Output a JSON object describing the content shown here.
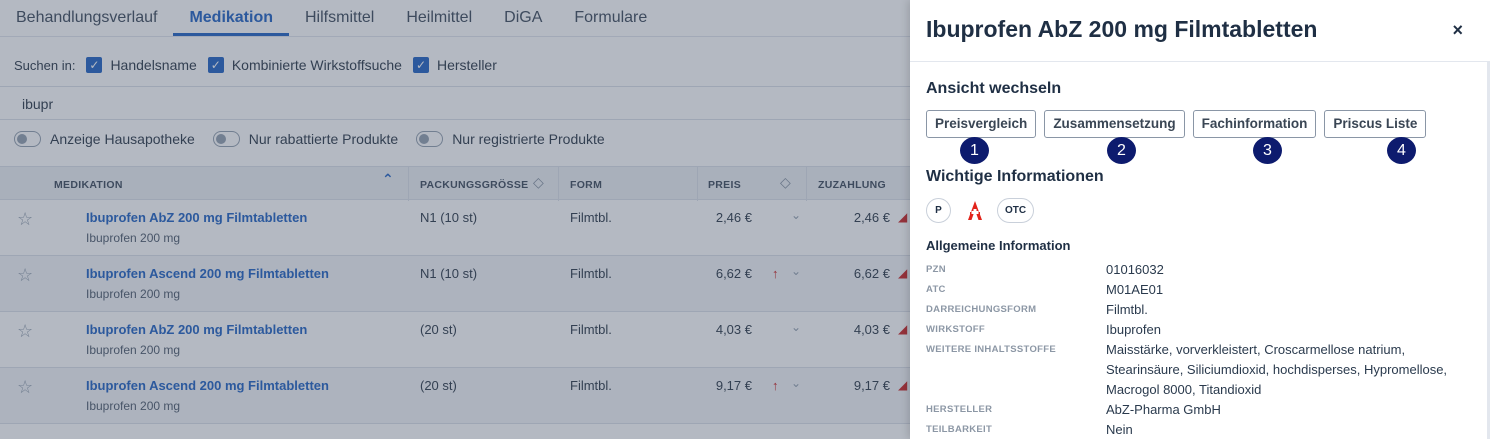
{
  "tabs": [
    "Behandlungsverlauf",
    "Medikation",
    "Hilfsmittel",
    "Heilmittel",
    "DiGA",
    "Formulare"
  ],
  "active_tab": "Medikation",
  "search": {
    "label": "Suchen in:",
    "options": [
      "Handelsname",
      "Kombinierte Wirkstoffsuche",
      "Hersteller"
    ],
    "value": "ibupr"
  },
  "toggles": [
    "Anzeige Hausapotheke",
    "Nur rabattierte Produkte",
    "Nur registrierte Produkte"
  ],
  "table": {
    "headers": [
      "MEDIKATION",
      "PACKUNGSGRÖSSE",
      "FORM",
      "PREIS",
      "ZUZAHLUNG"
    ],
    "rows": [
      {
        "name": "Ibuprofen AbZ 200 mg Filmtabletten",
        "sub": "Ibuprofen 200 mg",
        "size": "N1 (10 st)",
        "form": "Filmtbl.",
        "price": "2,46 €",
        "up": false,
        "copay": "2,46 €"
      },
      {
        "name": "Ibuprofen Ascend 200 mg Filmtabletten",
        "sub": "Ibuprofen 200 mg",
        "size": "N1 (10 st)",
        "form": "Filmtbl.",
        "price": "6,62 €",
        "up": true,
        "copay": "6,62 €"
      },
      {
        "name": "Ibuprofen AbZ 200 mg Filmtabletten",
        "sub": "Ibuprofen 200 mg",
        "size": "(20 st)",
        "form": "Filmtbl.",
        "price": "4,03 €",
        "up": false,
        "copay": "4,03 €"
      },
      {
        "name": "Ibuprofen Ascend 200 mg Filmtabletten",
        "sub": "Ibuprofen 200 mg",
        "size": "(20 st)",
        "form": "Filmtbl.",
        "price": "9,17 €",
        "up": true,
        "copay": "9,17 €"
      }
    ]
  },
  "panel": {
    "title": "Ibuprofen AbZ 200 mg Filmtabletten",
    "close": "×",
    "view_section": "Ansicht wechseln",
    "view_buttons": [
      "Preisvergleich",
      "Zusammensetzung",
      "Fachinformation",
      "Priscus Liste"
    ],
    "badges": [
      "1",
      "2",
      "3",
      "4"
    ],
    "important_section": "Wichtige Informationen",
    "pills": [
      "P",
      "OTC"
    ],
    "general_title": "Allgemeine Information",
    "info": [
      {
        "key": "PZN",
        "value": "01016032"
      },
      {
        "key": "ATC",
        "value": "M01AE01"
      },
      {
        "key": "DARREICHUNGSFORM",
        "value": "Filmtbl."
      },
      {
        "key": "WIRKSTOFF",
        "value": "Ibuprofen"
      },
      {
        "key": "WEITERE INHALTSSTOFFE",
        "value": "Maisstärke, vorverkleistert, Croscarmellose natrium, Stearinsäure, Siliciumdioxid, hochdisperses, Hypromellose, Macrogol 8000, Titandioxid"
      },
      {
        "key": "HERSTELLER",
        "value": "AbZ-Pharma GmbH"
      },
      {
        "key": "TEILBARKEIT",
        "value": "Nein"
      }
    ]
  },
  "colors": {
    "accent": "#2e6cc7",
    "badge": "#0d1b6e",
    "apotheke_red": "#e2231a"
  }
}
